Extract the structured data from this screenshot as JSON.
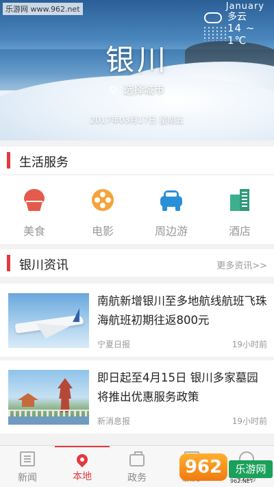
{
  "site_mark": "乐游网 www.962.net",
  "hero": {
    "city": "银川",
    "choose_city": "选择城市",
    "date": "2017年03月17日 星期五",
    "weather": {
      "month": "January",
      "condition": "多云",
      "temperature": "14 ~ 1℃"
    }
  },
  "services": {
    "title": "生活服务",
    "items": [
      {
        "label": "美食",
        "icon": "cupcake-icon"
      },
      {
        "label": "电影",
        "icon": "film-reel-icon"
      },
      {
        "label": "周边游",
        "icon": "car-icon"
      },
      {
        "label": "酒店",
        "icon": "buildings-icon"
      }
    ]
  },
  "news": {
    "title": "银川资讯",
    "more": "更多资讯>>",
    "items": [
      {
        "headline": "南航新增银川至多地航线航班飞珠海航班初期往返800元",
        "source": "宁夏日报",
        "time": "19小时前"
      },
      {
        "headline": "即日起至4月15日 银川多家墓园将推出优惠服务政策",
        "source": "新消息报",
        "time": "19小时前"
      }
    ]
  },
  "tabbar": {
    "tabs": [
      {
        "label": "新闻",
        "icon": "newspaper-icon"
      },
      {
        "label": "本地",
        "icon": "location-pin-icon",
        "active": true
      },
      {
        "label": "政务",
        "icon": "briefcase-icon"
      },
      {
        "label": "服务",
        "icon": "gift-icon"
      },
      {
        "label": "我的",
        "icon": "user-icon"
      }
    ]
  },
  "watermark": {
    "logo": "962",
    "text": "乐游网",
    "url": "962.NET"
  },
  "colors": {
    "accent": "#e4393c",
    "food": "#e45b4b",
    "movie": "#f3a43b",
    "travel": "#2b8fd8",
    "hotel": "#3bb08f"
  }
}
